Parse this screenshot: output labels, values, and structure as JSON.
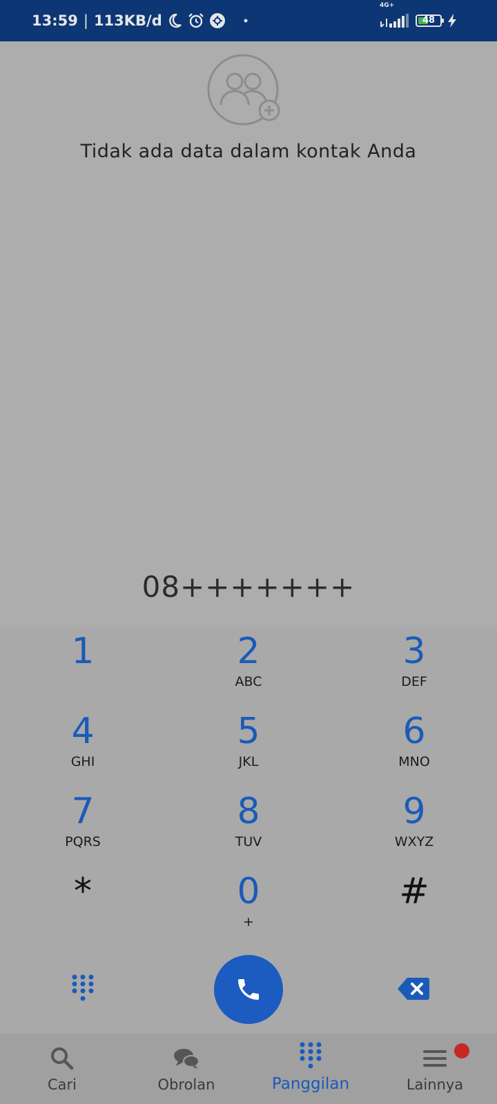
{
  "status_bar": {
    "time": "13:59",
    "separator": "|",
    "data_speed": "113KB/d",
    "network_type": "4G+",
    "battery_level": "48",
    "icons": [
      "moon-icon",
      "alarm-icon",
      "settings-badge-icon",
      "dot-icon",
      "signal-icon",
      "battery-icon",
      "charging-icon"
    ]
  },
  "empty_state": {
    "icon": "add-contacts-icon",
    "message": "Tidak ada data dalam kontak Anda"
  },
  "dialer": {
    "number": "08+++++++",
    "keys": [
      {
        "digit": "1",
        "letters": ""
      },
      {
        "digit": "2",
        "letters": "ABC"
      },
      {
        "digit": "3",
        "letters": "DEF"
      },
      {
        "digit": "4",
        "letters": "GHI"
      },
      {
        "digit": "5",
        "letters": "JKL"
      },
      {
        "digit": "6",
        "letters": "MNO"
      },
      {
        "digit": "7",
        "letters": "PQRS"
      },
      {
        "digit": "8",
        "letters": "TUV"
      },
      {
        "digit": "9",
        "letters": "WXYZ"
      },
      {
        "digit": "*",
        "letters": ""
      },
      {
        "digit": "0",
        "letters": "+"
      },
      {
        "digit": "#",
        "letters": ""
      }
    ],
    "actions": {
      "dialpad_toggle": "dialpad-icon",
      "call": "phone-icon",
      "backspace": "backspace-icon"
    }
  },
  "bottom_nav": {
    "items": [
      {
        "label": "Cari",
        "icon": "search-icon",
        "active": false
      },
      {
        "label": "Obrolan",
        "icon": "chat-icon",
        "active": false
      },
      {
        "label": "Panggilan",
        "icon": "dialpad-icon",
        "active": true
      },
      {
        "label": "Lainnya",
        "icon": "menu-icon",
        "active": false,
        "badge": true
      }
    ]
  },
  "colors": {
    "status_bar": "#0c3674",
    "background": "#adadad",
    "accent": "#1a5bb8",
    "call_button": "#1c5bbf",
    "badge": "#c62828",
    "battery_fill": "#4caf50"
  }
}
